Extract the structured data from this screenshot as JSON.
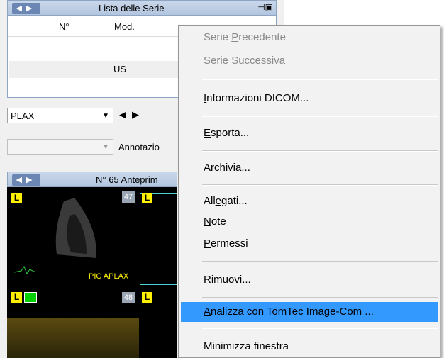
{
  "series_panel": {
    "title": "Lista delle Serie",
    "col_num": "N°",
    "col_mod": "Mod.",
    "row_mod": "US"
  },
  "controls": {
    "view_select": "PLAX",
    "annotation_label": "Annotazio"
  },
  "preview_panel": {
    "title": "N° 65 Anteprim",
    "thumb1_number": "47",
    "thumb1_label": "PIC APLAX",
    "thumb2_number": "48",
    "badge_letter": "L"
  },
  "context_menu": {
    "items": [
      {
        "pre": "Serie ",
        "u": "P",
        "post": "recedente",
        "disabled": true
      },
      {
        "pre": "Serie ",
        "u": "S",
        "post": "uccessiva",
        "disabled": true
      },
      {
        "pre": "",
        "u": "I",
        "post": "nformazioni DICOM...",
        "disabled": false
      },
      {
        "pre": "",
        "u": "E",
        "post": "sporta...",
        "disabled": false
      },
      {
        "pre": "",
        "u": "A",
        "post": "rchivia...",
        "disabled": false
      },
      {
        "pre": "All",
        "u": "e",
        "post": "gati...",
        "disabled": false
      },
      {
        "pre": "",
        "u": "N",
        "post": "ote",
        "disabled": false
      },
      {
        "pre": "",
        "u": "P",
        "post": "ermessi",
        "disabled": false
      },
      {
        "pre": "",
        "u": "R",
        "post": "imuovi...",
        "disabled": false
      },
      {
        "pre": "",
        "u": "A",
        "post": "nalizza con TomTec Image-Com ...",
        "disabled": false,
        "highlighted": true
      },
      {
        "pre": "Minimizza finestra",
        "u": "",
        "post": "",
        "disabled": false
      }
    ]
  },
  "colors": {
    "highlight": "#3399ff",
    "badge_yellow": "#ffef00",
    "badge_green": "#00d000"
  }
}
